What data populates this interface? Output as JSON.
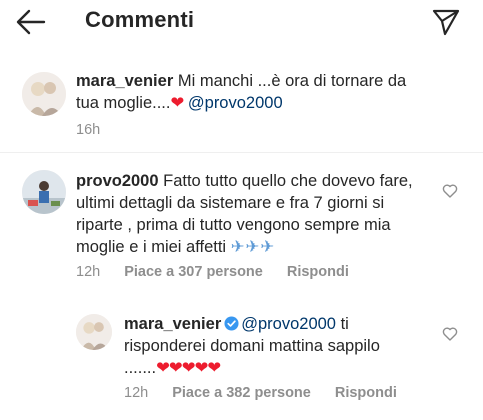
{
  "header": {
    "title": "Commenti"
  },
  "caption": {
    "username": "mara_venier",
    "text": " Mi manchi ...è ora di tornare da tua moglie....",
    "heart": "❤",
    "mention": "@provo2000",
    "time": "16h"
  },
  "comment": {
    "username": "provo2000",
    "text": " Fatto tutto quello che dovevo fare, ultimi dettagli da sistemare e fra 7 giorni si riparte , prima di tutto vengono sempre mia moglie e i miei affetti ",
    "planes": "✈✈✈",
    "time": "12h",
    "likes": "Piace a 307 persone",
    "reply": "Rispondi"
  },
  "reply": {
    "username": "mara_venier",
    "mention": "@provo2000",
    "text": " ti risponderei domani mattina sappilo .......",
    "hearts": "❤❤❤❤❤",
    "time": "12h",
    "likes": "Piace a 382 persone",
    "reply": "Rispondi"
  },
  "colors": {
    "text": "#262626",
    "secondary": "#8e8e8e",
    "mention": "#00376b",
    "heart": "#ed1c2e",
    "verified": "#3897f0"
  },
  "icons": {
    "back": "arrow-left-icon",
    "send": "paper-plane-icon",
    "like": "heart-outline-icon",
    "verified": "verified-badge-icon"
  }
}
